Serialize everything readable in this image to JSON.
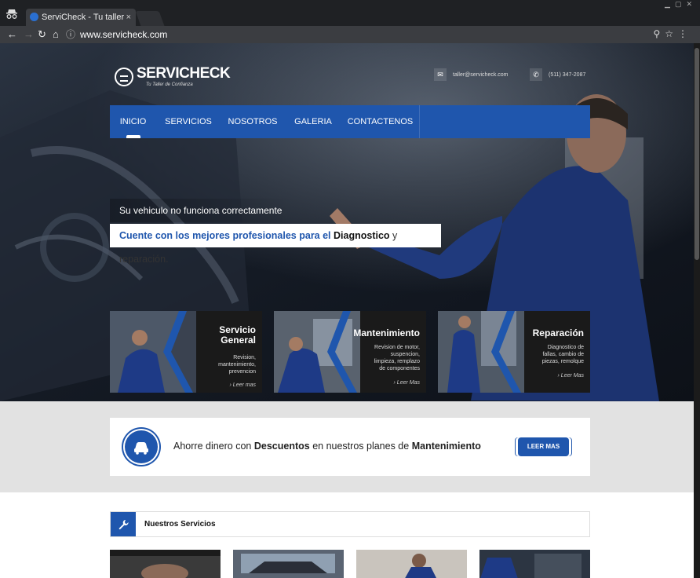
{
  "browser": {
    "tab_title": "ServiCheck - Tu taller",
    "tab_close": "×",
    "url": "www.servicheck.com",
    "info_icon": "ⓘ"
  },
  "site": {
    "logo_text": "SERVICHECK",
    "logo_tagline": "Tu Taller de Confianza",
    "email": "taller@servicheck.com",
    "phone": "(511) 347-2087",
    "nav": [
      "INICIO",
      "SERVICIOS",
      "NOSOTROS",
      "GALERIA",
      "CONTACTENOS"
    ],
    "active_nav": "INICIO",
    "hero": {
      "line1": "Su vehiculo no funciona correctamente",
      "line2_a": "Cuente con los mejores profesionales para el",
      "line2_b": "Diagnostico",
      "line2_c": "y reparación."
    },
    "cards": [
      {
        "title_1": "Servicio",
        "title_2": "General",
        "desc": [
          "Revision,",
          "mantenimiento,",
          "prevencion"
        ],
        "more": "› Leer mas"
      },
      {
        "title_1": "Mantenimiento",
        "title_2": "",
        "desc": [
          "Revision de motor,",
          "suspencion,",
          "limpieza, remplazo",
          "de componentes"
        ],
        "more": "› Leer Mas"
      },
      {
        "title_1": "Reparación",
        "title_2": "",
        "desc": [
          "Diagnostico de",
          "fallas, cambio de",
          "piezas, remolque"
        ],
        "more": "› Leer Mas"
      }
    ],
    "promo": {
      "text_a": "Ahorre dinero con",
      "text_b": "Descuentos",
      "text_c": "en nuestros planes de",
      "text_d": "Mantenimiento",
      "button": "LEER MAS"
    },
    "services_title": "Nuestros Servicios"
  },
  "colors": {
    "brand_blue": "#1f56ad",
    "chrome_dark": "#3b3d41"
  }
}
